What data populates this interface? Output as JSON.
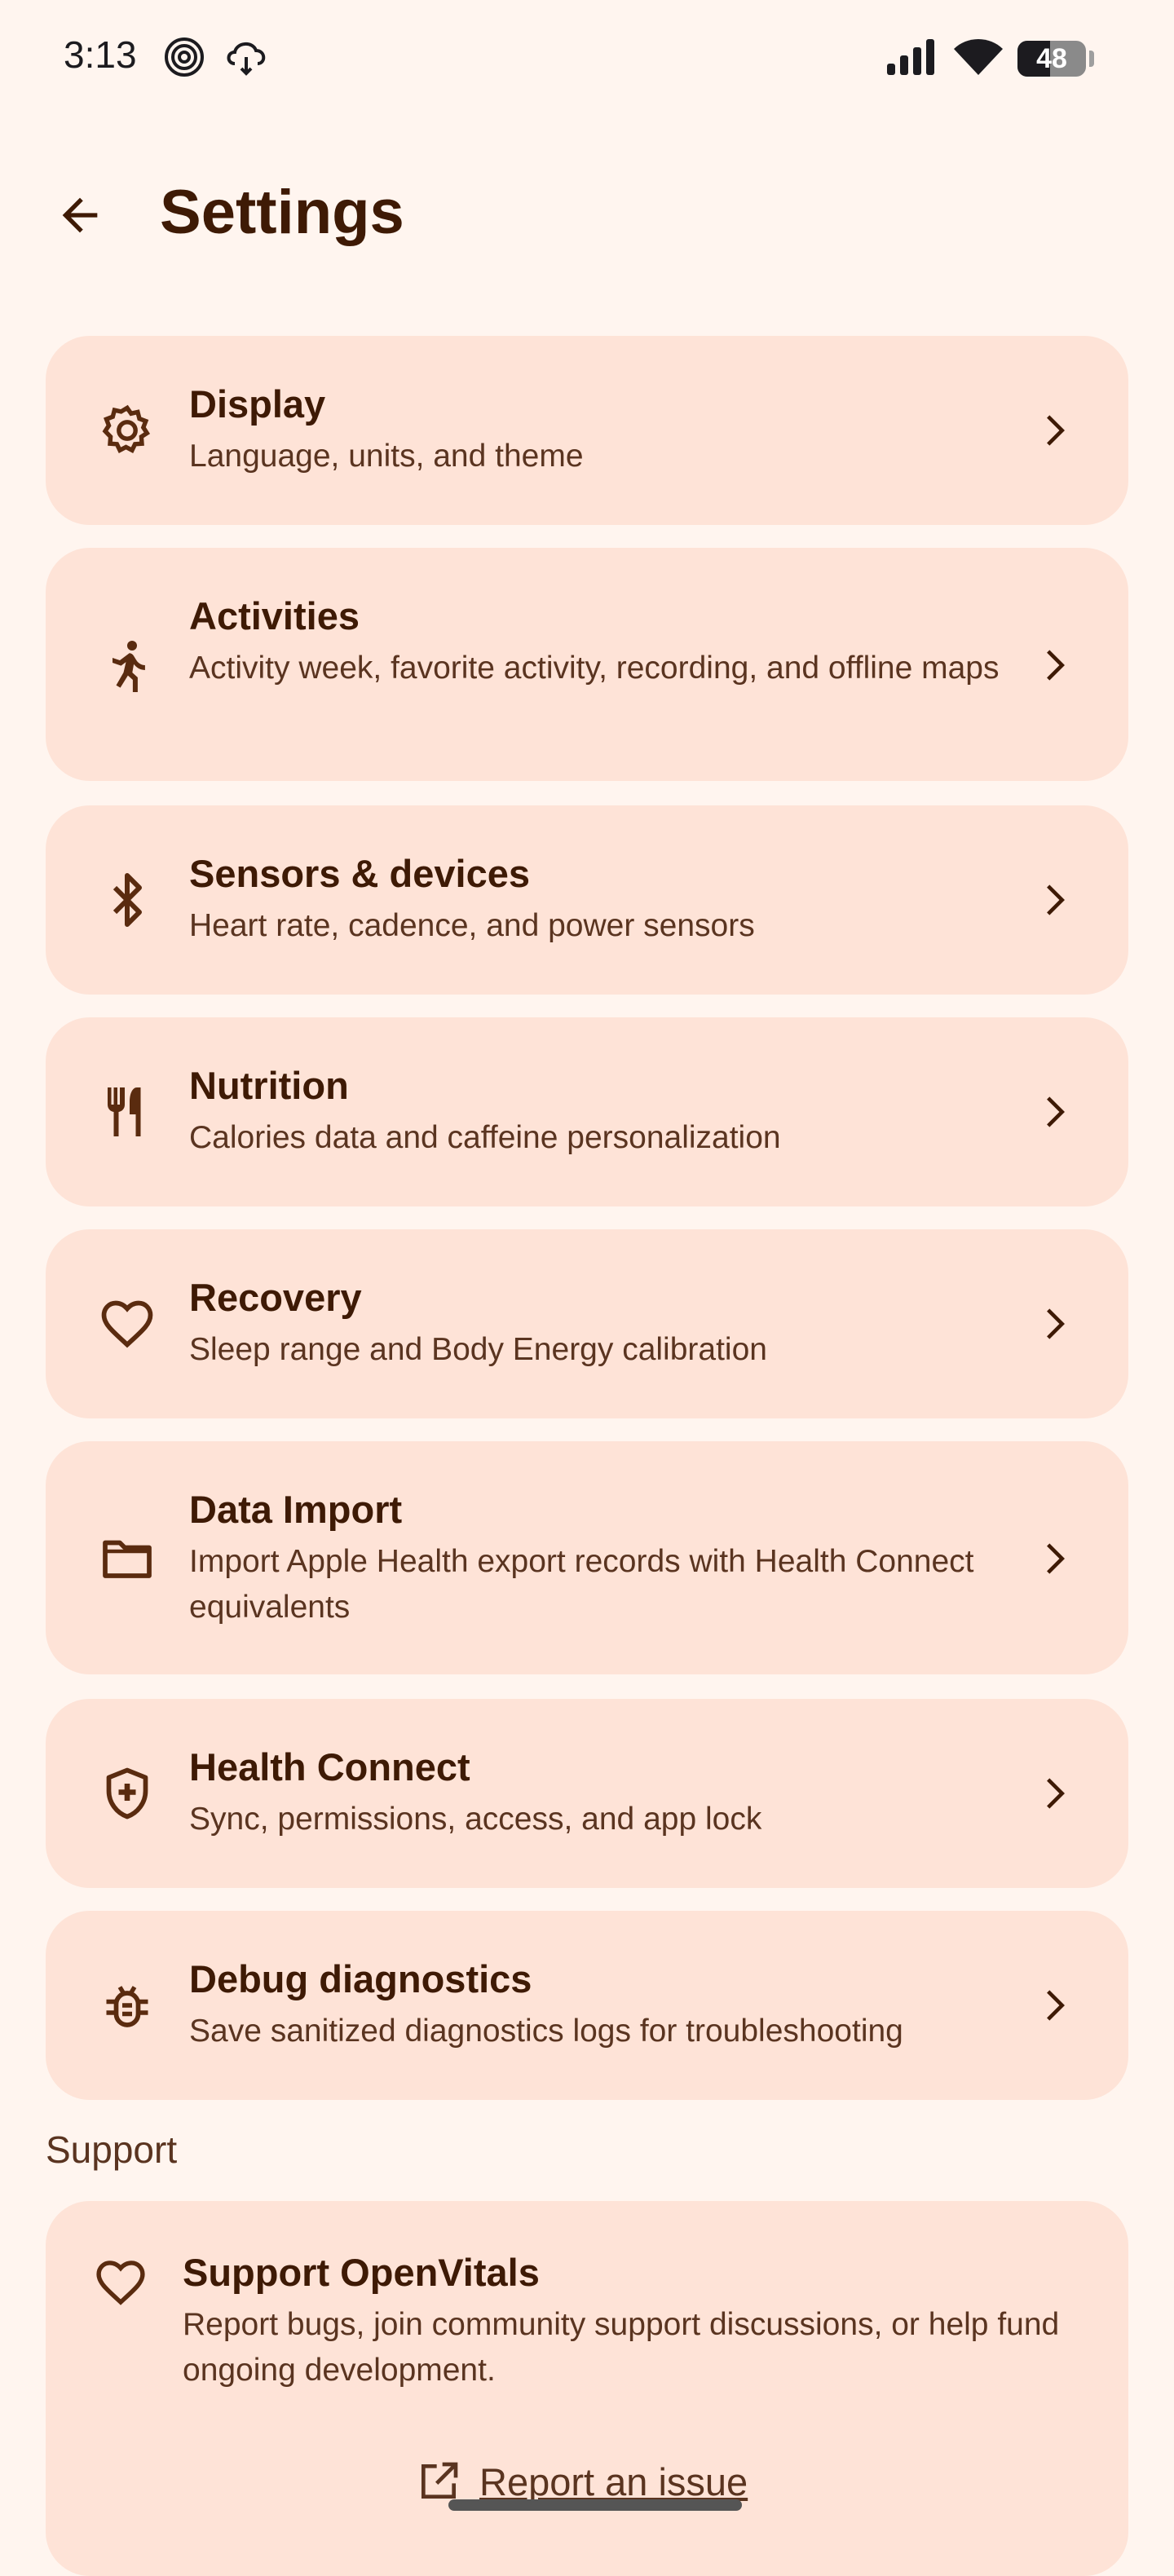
{
  "status": {
    "time": "3:13",
    "battery": "48",
    "battery_level": 0.48
  },
  "header": {
    "title": "Settings"
  },
  "cards": [
    {
      "title": "Display",
      "subtitle": "Language, units, and theme",
      "icon": "gear-icon"
    },
    {
      "title": "Activities",
      "subtitle": "Activity week, favorite activity, recording, and offline maps",
      "icon": "run-icon"
    },
    {
      "title": "Sensors & devices",
      "subtitle": "Heart rate, cadence, and power sensors",
      "icon": "bluetooth-icon"
    },
    {
      "title": "Nutrition",
      "subtitle": "Calories data and caffeine personalization",
      "icon": "fork-knife-icon"
    },
    {
      "title": "Recovery",
      "subtitle": "Sleep range and Body Energy calibration",
      "icon": "heart-icon"
    },
    {
      "title": "Data Import",
      "subtitle": "Import Apple Health export records with Health Connect equivalents",
      "icon": "folder-icon"
    },
    {
      "title": "Health Connect",
      "subtitle": "Sync, permissions, access, and app lock",
      "icon": "shield-plus-icon"
    },
    {
      "title": "Debug diagnostics",
      "subtitle": "Save sanitized diagnostics logs for troubleshooting",
      "icon": "bug-icon"
    }
  ],
  "support": {
    "section_label": "Support",
    "title": "Support OpenVitals",
    "subtitle": "Report bugs, join community support discussions, or help fund ongoing development.",
    "link_label": "Report an issue"
  },
  "colors": {
    "background": "#fff5ef",
    "card": "#fee3d7",
    "text": "#3e1a05",
    "subtext": "#5a3420"
  }
}
